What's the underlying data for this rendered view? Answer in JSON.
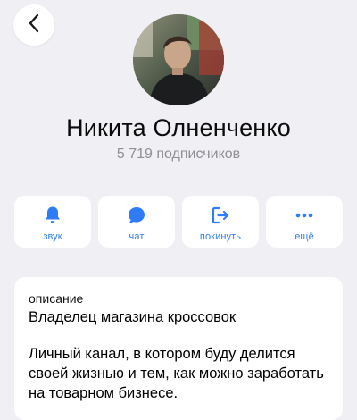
{
  "header": {
    "back_icon": "chevron-left-icon"
  },
  "profile": {
    "name": "Никита Олненченко",
    "subscribers": "5 719 подписчиков"
  },
  "actions": [
    {
      "label": "звук",
      "icon": "bell-icon"
    },
    {
      "label": "чат",
      "icon": "chat-bubble-icon"
    },
    {
      "label": "покинуть",
      "icon": "leave-icon"
    },
    {
      "label": "ещё",
      "icon": "more-dots-icon"
    }
  ],
  "description": {
    "label": "описание",
    "title": "Владелец магазина кроссовок",
    "text": "Личный канал, в котором буду делится своей жизнью и тем, как можно заработать на товарном бизнесе."
  },
  "colors": {
    "accent": "#2f7df6",
    "background": "#efeff4",
    "card": "#ffffff",
    "secondary_text": "#8e8e93"
  }
}
